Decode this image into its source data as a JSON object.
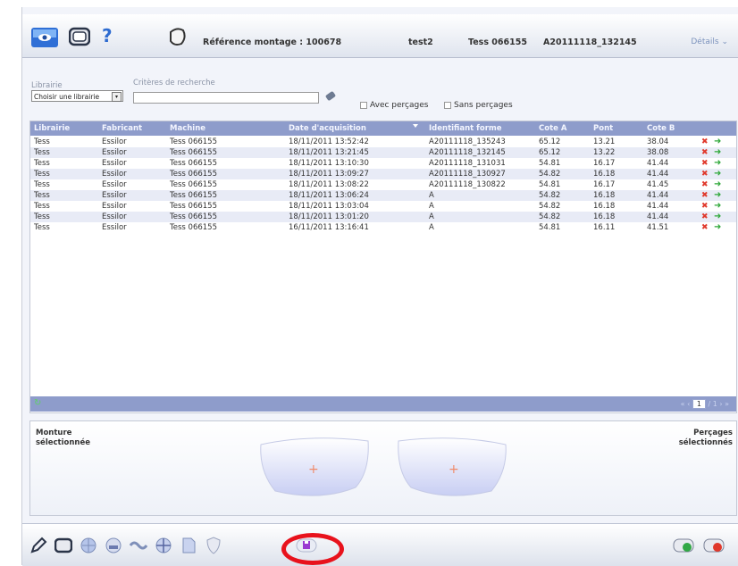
{
  "header": {
    "help": "?",
    "reference_label": "Référence montage : 100678",
    "user": "test2",
    "device": "Tess 066155",
    "shape_id": "A20111118_132145",
    "details": "Détails"
  },
  "search": {
    "library_label": "Librairie",
    "library_value": "Choisir une librairie",
    "criteria_label": "Critères de recherche",
    "criteria_value": "",
    "with_drilling": "Avec perçages",
    "without_drilling": "Sans perçages"
  },
  "table": {
    "columns": [
      "Librairie",
      "Fabricant",
      "Machine",
      "Date d'acquisition",
      "Identifiant forme",
      "Cote A",
      "Pont",
      "Cote B"
    ],
    "rows": [
      [
        "Tess",
        "Essilor",
        "Tess 066155",
        "18/11/2011 13:52:42",
        "A20111118_135243",
        "65.12",
        "13.21",
        "38.04"
      ],
      [
        "Tess",
        "Essilor",
        "Tess 066155",
        "18/11/2011 13:21:45",
        "A20111118_132145",
        "65.12",
        "13.22",
        "38.08"
      ],
      [
        "Tess",
        "Essilor",
        "Tess 066155",
        "18/11/2011 13:10:30",
        "A20111118_131031",
        "54.81",
        "16.17",
        "41.44"
      ],
      [
        "Tess",
        "Essilor",
        "Tess 066155",
        "18/11/2011 13:09:27",
        "A20111118_130927",
        "54.82",
        "16.18",
        "41.44"
      ],
      [
        "Tess",
        "Essilor",
        "Tess 066155",
        "18/11/2011 13:08:22",
        "A20111118_130822",
        "54.81",
        "16.17",
        "41.45"
      ],
      [
        "Tess",
        "Essilor",
        "Tess 066155",
        "18/11/2011 13:06:24",
        "A",
        "54.82",
        "16.18",
        "41.44"
      ],
      [
        "Tess",
        "Essilor",
        "Tess 066155",
        "18/11/2011 13:03:04",
        "A",
        "54.82",
        "16.18",
        "41.44"
      ],
      [
        "Tess",
        "Essilor",
        "Tess 066155",
        "18/11/2011 13:01:20",
        "A",
        "54.82",
        "16.18",
        "41.44"
      ],
      [
        "Tess",
        "Essilor",
        "Tess 066155",
        "16/11/2011 13:16:41",
        "A",
        "54.81",
        "16.11",
        "41.51"
      ]
    ],
    "pager_current": "1",
    "pager_total": "/ 1"
  },
  "preview": {
    "left_label_1": "Monture",
    "left_label_2": "sélectionnée",
    "right_label_1": "Perçages",
    "right_label_2": "sélectionnés"
  },
  "colors": {
    "header_row": "#8e9ccb",
    "delete": "#e0382b",
    "select": "#2fa83a",
    "highlight": "#e8121c"
  },
  "icons": [
    "logo-icon",
    "frame-icon",
    "help-icon",
    "lens-shape-icon",
    "details-chevron-icon",
    "eraser-icon",
    "refresh-icon",
    "pencil-icon",
    "frame-tool-icon",
    "globe-icon",
    "bifocal-icon",
    "wave-icon",
    "crosshair-icon",
    "file-icon",
    "shield-icon",
    "save-cart-icon",
    "validate-icon",
    "cancel-icon"
  ]
}
